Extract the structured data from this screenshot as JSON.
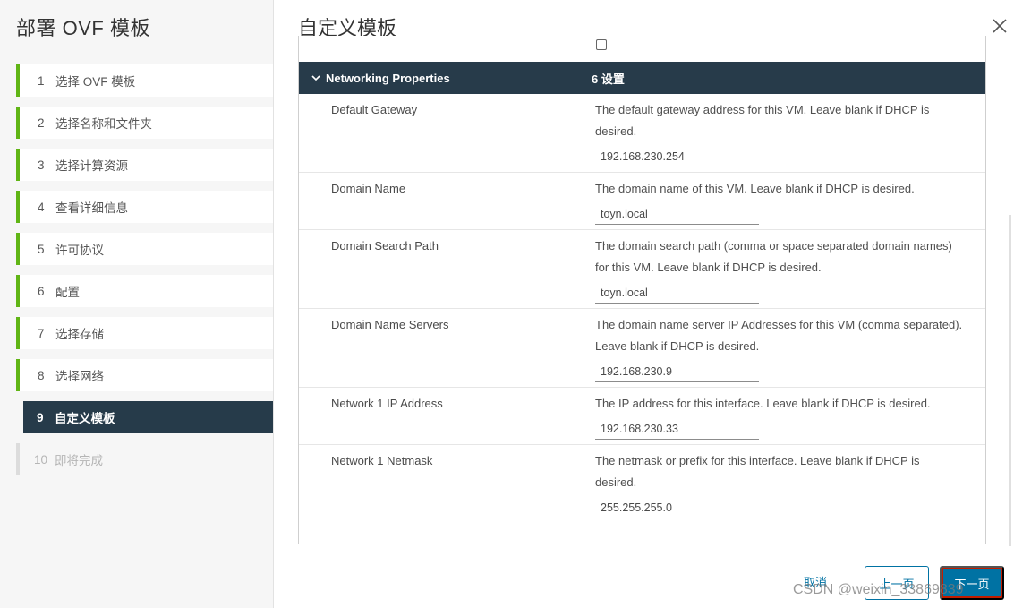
{
  "sidebar": {
    "title": "部署 OVF 模板",
    "steps": [
      {
        "num": "1",
        "label": "选择 OVF 模板"
      },
      {
        "num": "2",
        "label": "选择名称和文件夹"
      },
      {
        "num": "3",
        "label": "选择计算资源"
      },
      {
        "num": "4",
        "label": "查看详细信息"
      },
      {
        "num": "5",
        "label": "许可协议"
      },
      {
        "num": "6",
        "label": "配置"
      },
      {
        "num": "7",
        "label": "选择存储"
      },
      {
        "num": "8",
        "label": "选择网络"
      },
      {
        "num": "9",
        "label": "自定义模板"
      },
      {
        "num": "10",
        "label": "即将完成"
      }
    ]
  },
  "main": {
    "title": "自定义模板",
    "group": {
      "name": "Networking Properties",
      "count": "6 设置"
    },
    "properties": [
      {
        "label": "Default Gateway",
        "description": "The default gateway address for this VM. Leave blank if DHCP is desired.",
        "value": "192.168.230.254"
      },
      {
        "label": "Domain Name",
        "description": "The domain name of this VM. Leave blank if DHCP is desired.",
        "value": "toyn.local"
      },
      {
        "label": "Domain Search Path",
        "description": "The domain search path (comma or space separated domain names) for this VM. Leave blank if DHCP is desired.",
        "value": "toyn.local"
      },
      {
        "label": "Domain Name Servers",
        "description": "The domain name server IP Addresses for this VM (comma separated). Leave blank if DHCP is desired.",
        "value": "192.168.230.9"
      },
      {
        "label": "Network 1 IP Address",
        "description": "The IP address for this interface. Leave blank if DHCP is desired.",
        "value": "192.168.230.33"
      },
      {
        "label": "Network 1 Netmask",
        "description": "The netmask or prefix for this interface. Leave blank if DHCP is desired.",
        "value": "255.255.255.0"
      }
    ]
  },
  "footer": {
    "cancel_label": "取消",
    "prev_label": "上一页",
    "next_label": "下一页"
  },
  "watermark": "CSDN @weixin_33869839",
  "colors": {
    "accent": "#0072a3",
    "nav_dark": "#263b4a",
    "step_complete": "#60b515"
  }
}
